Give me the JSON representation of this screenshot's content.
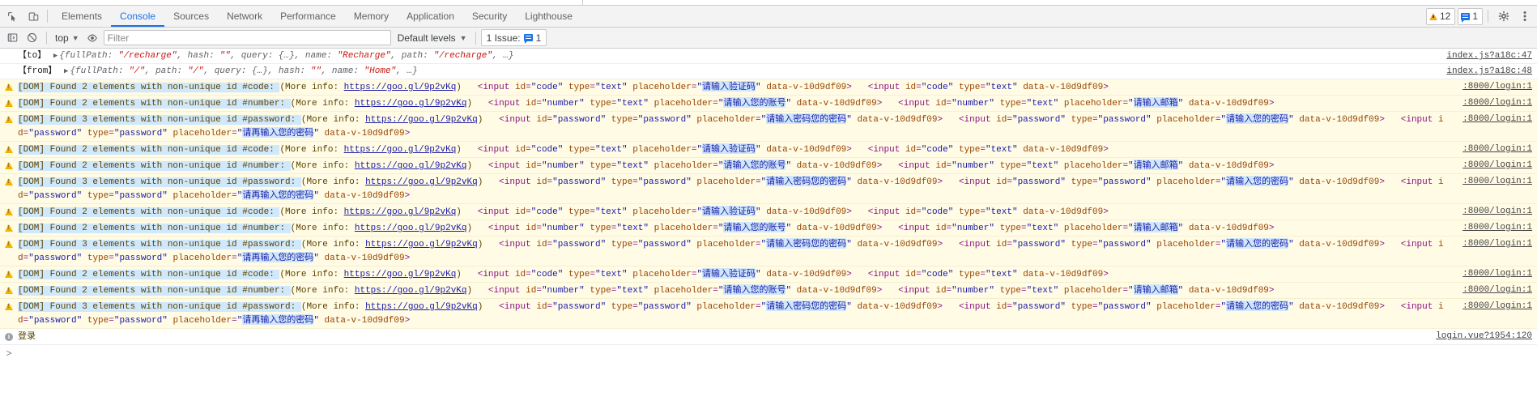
{
  "tabs": [
    {
      "label": "Elements",
      "active": false
    },
    {
      "label": "Console",
      "active": true
    },
    {
      "label": "Sources",
      "active": false
    },
    {
      "label": "Network",
      "active": false
    },
    {
      "label": "Performance",
      "active": false
    },
    {
      "label": "Memory",
      "active": false
    },
    {
      "label": "Application",
      "active": false
    },
    {
      "label": "Security",
      "active": false
    },
    {
      "label": "Lighthouse",
      "active": false
    }
  ],
  "counters": {
    "warnings": "12",
    "messages": "1"
  },
  "filterbar": {
    "context": "top",
    "filter_placeholder": "Filter",
    "filter_value": "",
    "levels": "Default levels",
    "issues_prefix": "1 Issue:",
    "issues_count": "1"
  },
  "colors": {
    "accent": "#1a73e8",
    "warning_bg": "#fffbe5",
    "warning_text": "#5c4300",
    "warning_icon": "#f2b200",
    "string": "#c41a16",
    "tag": "#881280",
    "attr_name": "#994500",
    "attr_value": "#1a1aa6",
    "selection": "#cfe8fc"
  },
  "strings": {
    "dom_prefix": "[DOM] Found ",
    "more_info": "(More info: ",
    "goo_link": "https://goo.gl/9p2vKq",
    "close_paren": ")",
    "input_tag_open": "<input ",
    "tag_close": ">",
    "id_attr": "id",
    "type_attr": "type",
    "placeholder_attr": "placeholder",
    "datav_attr": "data-v-10d9df09",
    "eq": "=",
    "quote": "\"",
    "label_to": "【to】",
    "label_from": "【from】",
    "login_text": "登录",
    "sources": {
      "index_47": "index.js?a18c:47",
      "index_48": "index.js?a18c:48",
      "login_1": ":8000/login:1",
      "login_vue": "login.vue?1954:120"
    },
    "ph_code": "请输入验证码",
    "ph_account": "请输入您的账号",
    "ph_email": "请输入邮箱",
    "ph_pwd": "请输入密码您的密码",
    "ph_pwd2": "请输入您的密码",
    "ph_pwd3": "请再输入您的密码",
    "id_code": "code",
    "id_number": "number",
    "id_password": "password",
    "type_text": "text",
    "type_password": "password",
    "found2": "2",
    "found3": "3",
    "elements_with": " elements with non-unique id #",
    "colon_space": ": "
  },
  "route_logs": [
    {
      "label": "【to】",
      "obj": "{fullPath: \"/recharge\", hash: \"\", query: {…}, name: \"Recharge\", path: \"/recharge\", …}",
      "parts": [
        {
          "t": "p",
          "v": "{"
        },
        {
          "t": "k",
          "v": "fullPath: "
        },
        {
          "t": "s",
          "v": "\"/recharge\""
        },
        {
          "t": "k",
          "v": ", hash: "
        },
        {
          "t": "s",
          "v": "\"\""
        },
        {
          "t": "k",
          "v": ", query: {…}, name: "
        },
        {
          "t": "s",
          "v": "\"Recharge\""
        },
        {
          "t": "k",
          "v": ", path: "
        },
        {
          "t": "s",
          "v": "\"/recharge\""
        },
        {
          "t": "k",
          "v": ", …}"
        }
      ],
      "source": "index.js?a18c:47"
    },
    {
      "label": "【from】",
      "obj": "{fullPath: \"/\", path: \"/\", query: {…}, hash: \"\", name: \"Home\", …}",
      "parts": [
        {
          "t": "p",
          "v": "{"
        },
        {
          "t": "k",
          "v": "fullPath: "
        },
        {
          "t": "s",
          "v": "\"/\""
        },
        {
          "t": "k",
          "v": ", path: "
        },
        {
          "t": "s",
          "v": "\"/\""
        },
        {
          "t": "k",
          "v": ", query: {…}, hash: "
        },
        {
          "t": "s",
          "v": "\"\""
        },
        {
          "t": "k",
          "v": ", name: "
        },
        {
          "t": "s",
          "v": "\"Home\""
        },
        {
          "t": "k",
          "v": ", …}"
        }
      ],
      "source": "index.js?a18c:48"
    }
  ],
  "warning_cycle": [
    {
      "count": "2",
      "id": "code",
      "source": ":8000/login:1",
      "inputs": [
        {
          "id": "code",
          "type": "text",
          "placeholder": "请输入验证码",
          "selected_ph": true
        },
        {
          "id": "code",
          "type": "text",
          "placeholder": null
        }
      ]
    },
    {
      "count": "2",
      "id": "number",
      "source": ":8000/login:1",
      "inputs": [
        {
          "id": "number",
          "type": "text",
          "placeholder": "请输入您的账号",
          "selected_ph": true
        },
        {
          "id": "number",
          "type": "text",
          "placeholder": "请输入邮箱",
          "selected_ph": true
        }
      ]
    },
    {
      "count": "3",
      "id": "password",
      "source": ":8000/login:1",
      "inputs": [
        {
          "id": "password",
          "type": "password",
          "placeholder": "请输入密码您的密码",
          "selected_ph": true
        },
        {
          "id": "password",
          "type": "password",
          "placeholder": "请输入您的密码",
          "selected_ph": true
        },
        {
          "id": "password",
          "type": "password",
          "placeholder": "请再输入您的密码",
          "selected_ph": true
        }
      ]
    }
  ],
  "cycles": 4,
  "info_row": {
    "text": "登录",
    "source": "login.vue?1954:120"
  },
  "prompt": {
    "caret": ">",
    "value": ""
  }
}
